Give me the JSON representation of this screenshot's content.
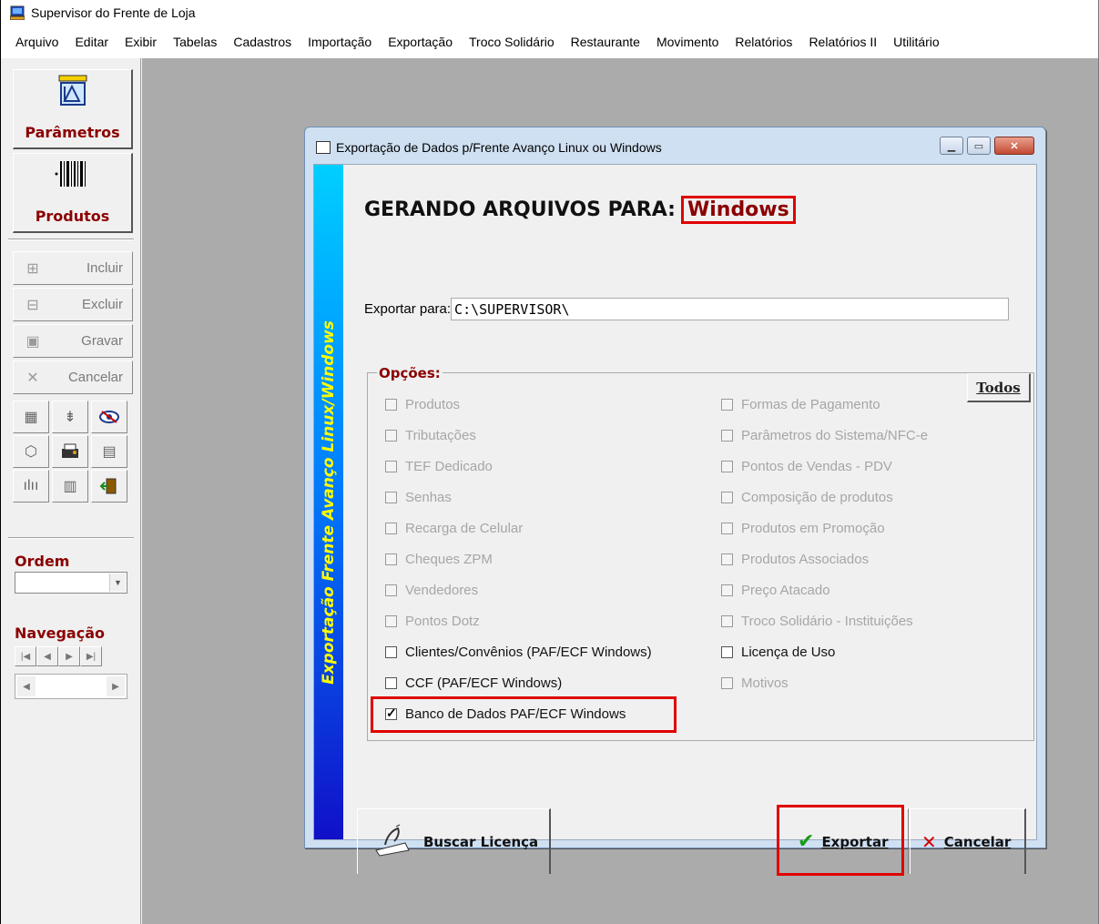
{
  "app": {
    "title": "Supervisor do Frente de Loja"
  },
  "menu": [
    "Arquivo",
    "Editar",
    "Exibir",
    "Tabelas",
    "Cadastros",
    "Importação",
    "Exportação",
    "Troco Solidário",
    "Restaurante",
    "Movimento",
    "Relatórios",
    "Relatórios II",
    "Utilitário"
  ],
  "toolbar": {
    "parametros_label": "Parâmetros",
    "produtos_label": "Produtos",
    "incluir": "Incluir",
    "excluir": "Excluir",
    "gravar": "Gravar",
    "cancelar": "Cancelar",
    "ordem_label": "Ordem",
    "navegacao_label": "Navegação"
  },
  "dialog": {
    "title": "Exportação de Dados p/Frente Avanço Linux ou Windows",
    "side_banner": "Exportação Frente Avanço Linux/Windows",
    "heading": "GERANDO ARQUIVOS PARA:",
    "target": "Windows",
    "export_label": "Exportar para:",
    "export_path": "C:\\SUPERVISOR\\",
    "options_legend": "Opções:",
    "todos_label": "Todos",
    "left_options": [
      {
        "label": "Produtos",
        "checked": false,
        "enabled": false
      },
      {
        "label": "Tributações",
        "checked": false,
        "enabled": false
      },
      {
        "label": "TEF Dedicado",
        "checked": false,
        "enabled": false
      },
      {
        "label": "Senhas",
        "checked": false,
        "enabled": false
      },
      {
        "label": "Recarga de Celular",
        "checked": false,
        "enabled": false
      },
      {
        "label": "Cheques ZPM",
        "checked": false,
        "enabled": false
      },
      {
        "label": "Vendedores",
        "checked": false,
        "enabled": false
      },
      {
        "label": "Pontos Dotz",
        "checked": false,
        "enabled": false
      },
      {
        "label": "Clientes/Convênios (PAF/ECF Windows)",
        "checked": false,
        "enabled": true
      },
      {
        "label": "CCF (PAF/ECF Windows)",
        "checked": false,
        "enabled": true
      },
      {
        "label": "Banco de Dados PAF/ECF Windows",
        "checked": true,
        "enabled": true
      }
    ],
    "right_options": [
      {
        "label": "Formas de Pagamento",
        "checked": false,
        "enabled": false
      },
      {
        "label": "Parâmetros do Sistema/NFC-e",
        "checked": false,
        "enabled": false
      },
      {
        "label": "Pontos de Vendas - PDV",
        "checked": false,
        "enabled": false
      },
      {
        "label": "Composição de produtos",
        "checked": false,
        "enabled": false
      },
      {
        "label": "Produtos em Promoção",
        "checked": false,
        "enabled": false
      },
      {
        "label": "Produtos Associados",
        "checked": false,
        "enabled": false
      },
      {
        "label": "Preço Atacado",
        "checked": false,
        "enabled": false
      },
      {
        "label": "Troco Solidário - Instituições",
        "checked": false,
        "enabled": false
      },
      {
        "label": "Licença de Uso",
        "checked": false,
        "enabled": true
      },
      {
        "label": "Motivos",
        "checked": false,
        "enabled": false
      }
    ],
    "buscar_label": "Buscar Licença",
    "exportar_label": "Exportar",
    "cancelar_label": "Cancelar"
  },
  "colors": {
    "accent_red": "#8b0000",
    "highlight": "#e00000",
    "banner_text": "#ffff00",
    "workspace": "#ababab"
  }
}
